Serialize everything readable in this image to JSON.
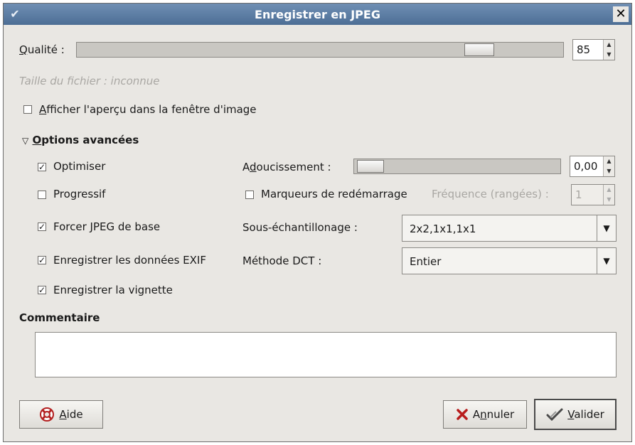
{
  "window": {
    "title": "Enregistrer en JPEG",
    "close_glyph": "✕",
    "menu_glyph": "✔"
  },
  "quality": {
    "label_first": "Q",
    "label_rest": "ualité :",
    "value": "85",
    "level": 0.85
  },
  "file_size_text": "Taille du fichier : inconnue",
  "preview": {
    "checked": false,
    "label_first": "A",
    "label_rest": "fficher l'aperçu dans la fenêtre d'image"
  },
  "advanced": {
    "expander_glyph": "▽",
    "title_first": "O",
    "title_rest": "ptions avancées",
    "optimize": {
      "checked": true,
      "label": "Optimiser"
    },
    "progressive": {
      "checked": false,
      "label": "Progressif"
    },
    "baseline": {
      "checked": true,
      "label": "Forcer JPEG de base"
    },
    "exif": {
      "checked": true,
      "label": "Enregistrer les données EXIF"
    },
    "thumbnail": {
      "checked": true,
      "label": "Enregistrer la vignette"
    },
    "smoothing": {
      "label_pre": "A",
      "label_u": "d",
      "label_post": "oucissement :",
      "value": "0,00",
      "level": 0.0
    },
    "restart": {
      "checked": false,
      "label": "Marqueurs de redémarrage",
      "freq_label": "Fréquence (rangées) :",
      "freq_value": "1"
    },
    "subsampling": {
      "label": "Sous-échantillonage :",
      "value": "2x2,1x1,1x1"
    },
    "dct": {
      "label": "Méthode DCT :",
      "value": "Entier"
    }
  },
  "comment": {
    "title": "Commentaire",
    "value": ""
  },
  "buttons": {
    "help": {
      "first": "A",
      "rest": "ide",
      "icon": "lifebuoy-icon"
    },
    "cancel": {
      "pre": "A",
      "u": "n",
      "post": "nuler",
      "icon": "x-icon"
    },
    "ok": {
      "first": "V",
      "rest": "alider",
      "icon": "check-icon"
    }
  }
}
